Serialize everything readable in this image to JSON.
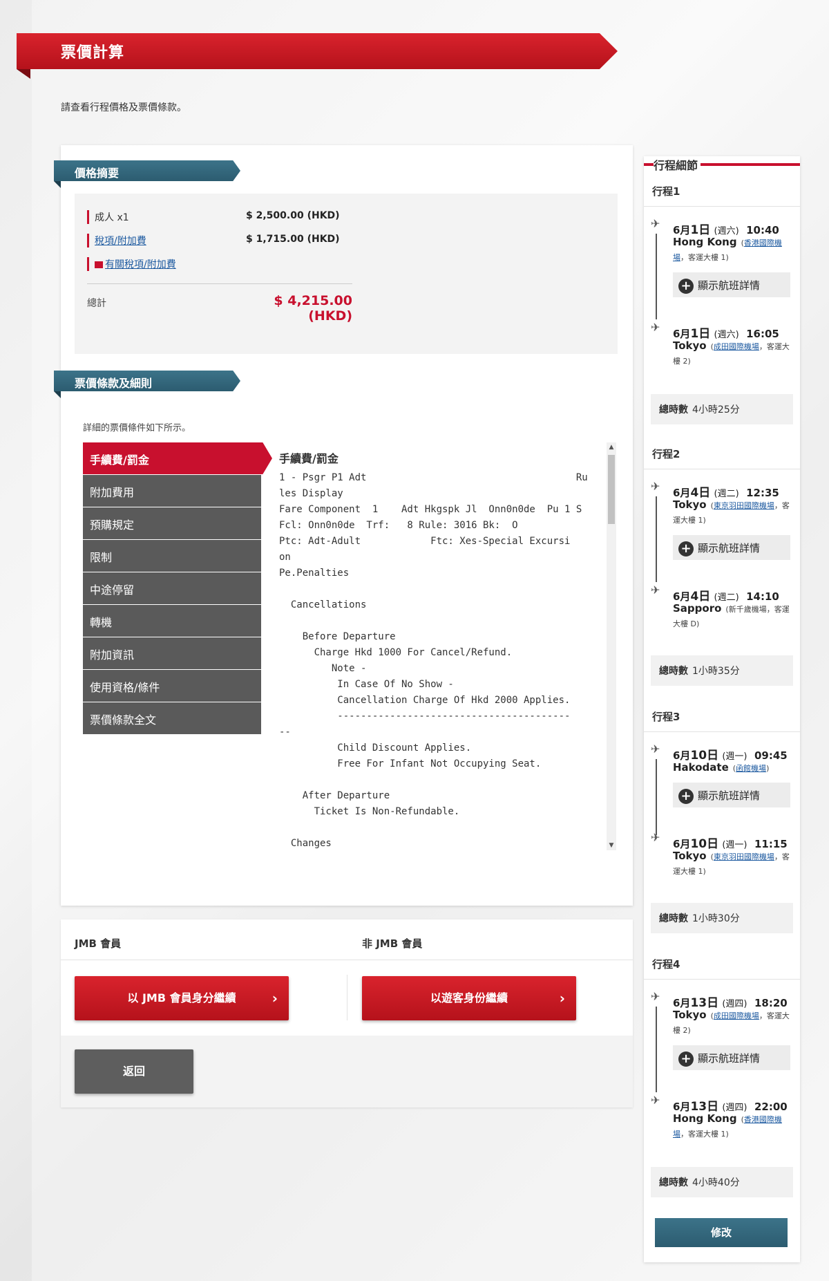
{
  "page": {
    "title": "票價計算",
    "intro": "請查看行程價格及票價條款。"
  },
  "price_summary": {
    "heading": "價格摘要",
    "rows": [
      {
        "label": "成人 x1",
        "value": "$ 2,500.00 (HKD)"
      },
      {
        "label": "稅項/附加費",
        "value": "$ 1,715.00 (HKD)"
      },
      {
        "label": "有關稅項/附加費",
        "value": ""
      }
    ],
    "total_label": "總計",
    "total_value": "$ 4,215.00 (HKD)"
  },
  "fare_rules": {
    "heading": "票價條款及細則",
    "intro": "詳細的票價條件如下所示。",
    "tabs": [
      "手續費/罰金",
      "附加費用",
      "預購規定",
      "限制",
      "中途停留",
      "轉機",
      "附加資訊",
      "使用資格/條件",
      "票價條款全文"
    ],
    "active_tab": "手續費/罰金",
    "content_heading": "手續費/罰金",
    "content_text": "1 - Psgr P1 Adt                                    Ru\nles Display\nFare Component  1    Adt Hkgspk Jl  Onn0n0de  Pu 1 S\nFcl: Onn0n0de  Trf:   8 Rule: 3016 Bk:  O\nPtc: Adt-Adult            Ftc: Xes-Special Excursi\non\nPe.Penalties\n\n  Cancellations\n\n    Before Departure\n      Charge Hkd 1000 For Cancel/Refund.\n         Note -\n          In Case Of No Show -\n          Cancellation Charge Of Hkd 2000 Applies.\n          ----------------------------------------\n--\n          Child Discount Applies.\n          Free For Infant Not Occupying Seat.\n\n    After Departure\n      Ticket Is Non-Refundable.\n\n  Changes"
  },
  "members": {
    "jmb_label": "JMB 會員",
    "non_jmb_label": "非 JMB 會員",
    "jmb_button": "以 JMB 會員身分繼續",
    "guest_button": "以遊客身份繼續",
    "back_button": "返回"
  },
  "itinerary": {
    "heading": "行程細節",
    "show_details_label": "顯示航班詳情",
    "duration_label": "總時數",
    "modify_button": "修改",
    "legs": [
      {
        "title": "行程1",
        "depart": {
          "month": "6月",
          "day": "1日",
          "weekday": "(週六)",
          "time": "10:40",
          "city": "Hong Kong",
          "airport_pre": "(",
          "airport": "香港國際機場",
          "airport_post": "，客運大樓 1)"
        },
        "arrive": {
          "month": "6月",
          "day": "1日",
          "weekday": "(週六)",
          "time": "16:05",
          "city": "Tokyo",
          "airport_pre": "(",
          "airport": "成田國際機場",
          "airport_post": "，客運大樓 2)"
        },
        "duration": "4小時25分"
      },
      {
        "title": "行程2",
        "depart": {
          "month": "6月",
          "day": "4日",
          "weekday": "(週二)",
          "time": "12:35",
          "city": "Tokyo",
          "airport_pre": "(",
          "airport": "東京羽田國際機場",
          "airport_post": "，客運大樓 1)"
        },
        "arrive": {
          "month": "6月",
          "day": "4日",
          "weekday": "(週二)",
          "time": "14:10",
          "city": "Sapporo",
          "airport_pre": "(新千歲機場，客運大樓 D)",
          "airport": "",
          "airport_post": ""
        },
        "duration": "1小時35分"
      },
      {
        "title": "行程3",
        "depart": {
          "month": "6月",
          "day": "10日",
          "weekday": "(週一)",
          "time": "09:45",
          "city": "Hakodate",
          "airport_pre": "(",
          "airport": "函館機場",
          "airport_post": ")"
        },
        "arrive": {
          "month": "6月",
          "day": "10日",
          "weekday": "(週一)",
          "time": "11:15",
          "city": "Tokyo",
          "airport_pre": "(",
          "airport": "東京羽田國際機場",
          "airport_post": "，客運大樓 1)"
        },
        "duration": "1小時30分"
      },
      {
        "title": "行程4",
        "depart": {
          "month": "6月",
          "day": "13日",
          "weekday": "(週四)",
          "time": "18:20",
          "city": "Tokyo",
          "airport_pre": "(",
          "airport": "成田國際機場",
          "airport_post": "，客運大樓 2)"
        },
        "arrive": {
          "month": "6月",
          "day": "13日",
          "weekday": "(週四)",
          "time": "22:00",
          "city": "Hong Kong",
          "airport_pre": "(",
          "airport": "香港國際機場",
          "airport_post": "，客運大樓 1)"
        },
        "duration": "4小時40分"
      }
    ]
  },
  "icons": {
    "departure": "plane-takeoff-icon",
    "arrival": "plane-landing-icon",
    "plus": "plus-circle-icon",
    "chevron": "chevron-right-icon",
    "document": "document-icon"
  },
  "colors": {
    "brand_red": "#c8102e",
    "ribbon_teal": "#2c5c70",
    "tab_gray": "#5a5a5a",
    "link_blue": "#1d5aa0"
  }
}
